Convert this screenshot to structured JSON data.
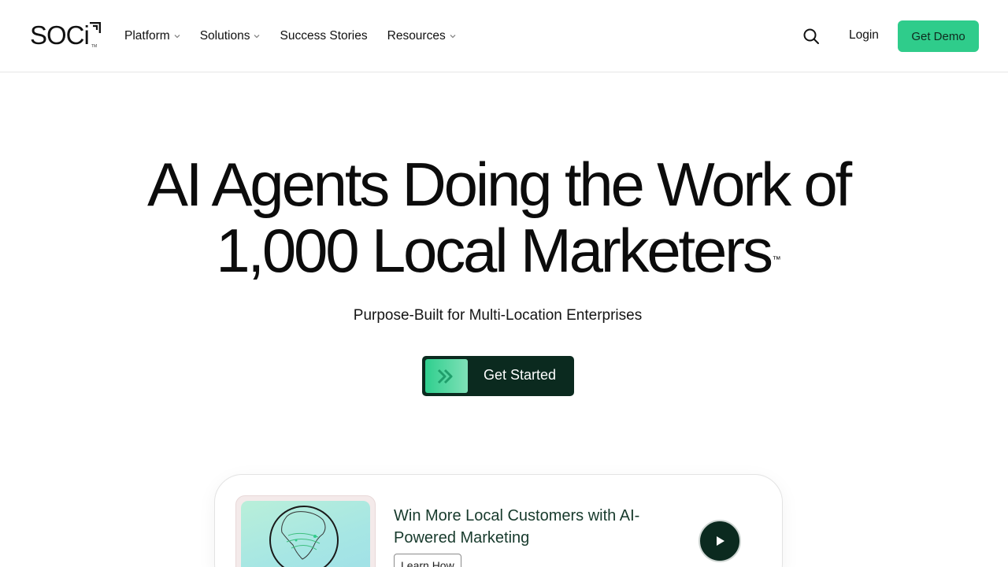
{
  "header": {
    "logo_text": "SOCi",
    "logo_tm": "TM",
    "nav": [
      {
        "label": "Platform",
        "has_dropdown": true
      },
      {
        "label": "Solutions",
        "has_dropdown": true
      },
      {
        "label": "Success Stories",
        "has_dropdown": false
      },
      {
        "label": "Resources",
        "has_dropdown": true
      }
    ],
    "search_icon": "search-icon",
    "login_label": "Login",
    "demo_label": "Get Demo"
  },
  "hero": {
    "title_line1": "AI Agents Doing the Work of",
    "title_line2": "1,000 Local Marketers",
    "title_tm": "™",
    "subtitle": "Purpose-Built for Multi-Location Enterprises",
    "cta_label": "Get Started",
    "cta_icon": "double-chevron-right-icon"
  },
  "card": {
    "title": "Win More Local Customers with AI-Powered Marketing",
    "learn_label": "Learn How",
    "thumb_icon": "globe-icon",
    "play_icon": "play-icon"
  },
  "colors": {
    "accent_green": "#2fcc8b",
    "dark_green": "#0b2a1f",
    "text": "#0d0d0d"
  }
}
